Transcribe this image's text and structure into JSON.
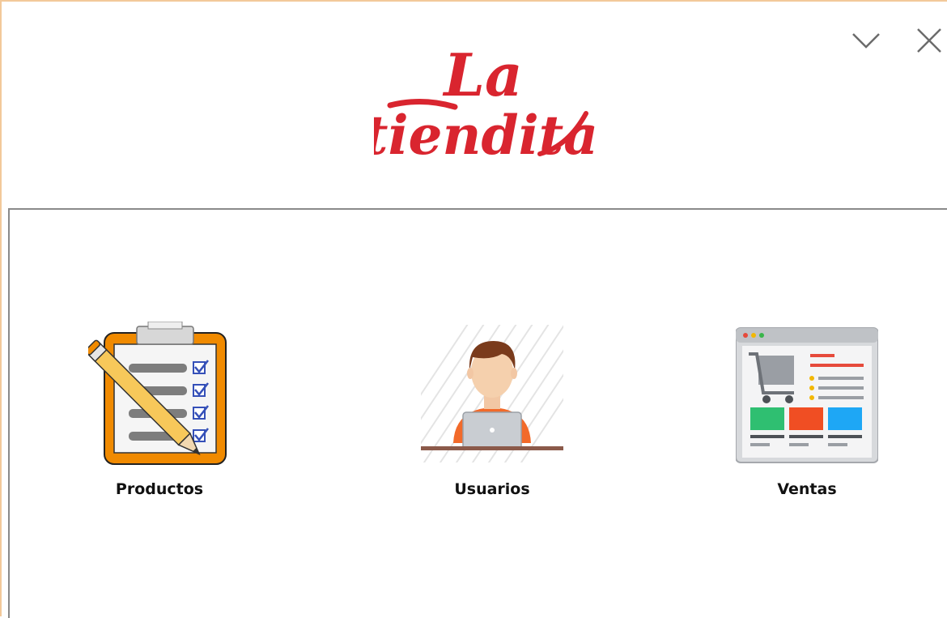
{
  "app": {
    "logo_text_line1": "La",
    "logo_text_line2": "tiendita",
    "brand_color": "#d9252f"
  },
  "window_controls": {
    "minimize_icon": "chevron-down-icon",
    "close_icon": "close-icon"
  },
  "menu": [
    {
      "label": "Productos",
      "icon": "clipboard-checklist-icon"
    },
    {
      "label": "Usuarios",
      "icon": "user-laptop-icon"
    },
    {
      "label": "Ventas",
      "icon": "shopping-web-page-icon"
    }
  ]
}
